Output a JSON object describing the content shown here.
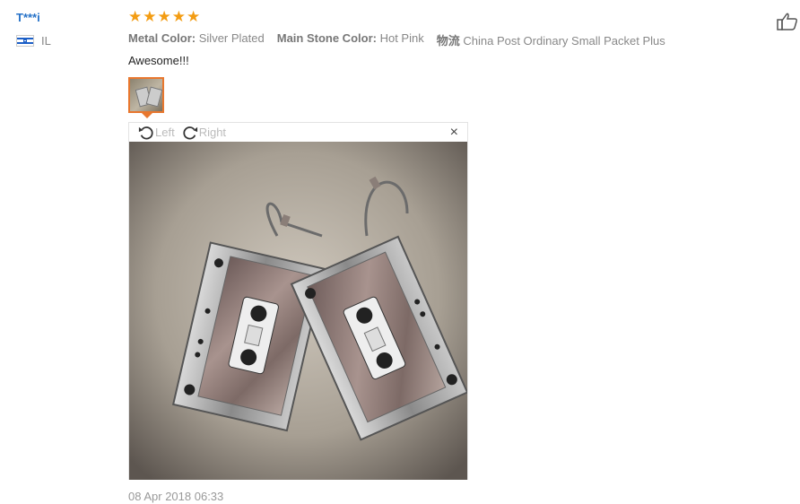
{
  "reviewer": {
    "name": "T***i",
    "country": "IL"
  },
  "rating": {
    "stars": "★★★★★",
    "value": 5
  },
  "attributes": {
    "metal_label": "Metal Color:",
    "metal_value": "Silver Plated",
    "stone_label": "Main Stone Color:",
    "stone_value": "Hot Pink",
    "shipping_label": "物流",
    "shipping_value": "China Post Ordinary Small Packet Plus"
  },
  "review": {
    "text": "Awesome!!!"
  },
  "viewer": {
    "rotate_left": "Left",
    "rotate_right": "Right",
    "close": "×"
  },
  "date": "08 Apr 2018 06:33",
  "colors": {
    "accent": "#e8772e",
    "name": "#2672c8",
    "stars": "#f39c12"
  },
  "icons": [
    "thumbs-up-icon",
    "rotate-left-icon",
    "rotate-right-icon",
    "close-icon",
    "flag-icon"
  ]
}
